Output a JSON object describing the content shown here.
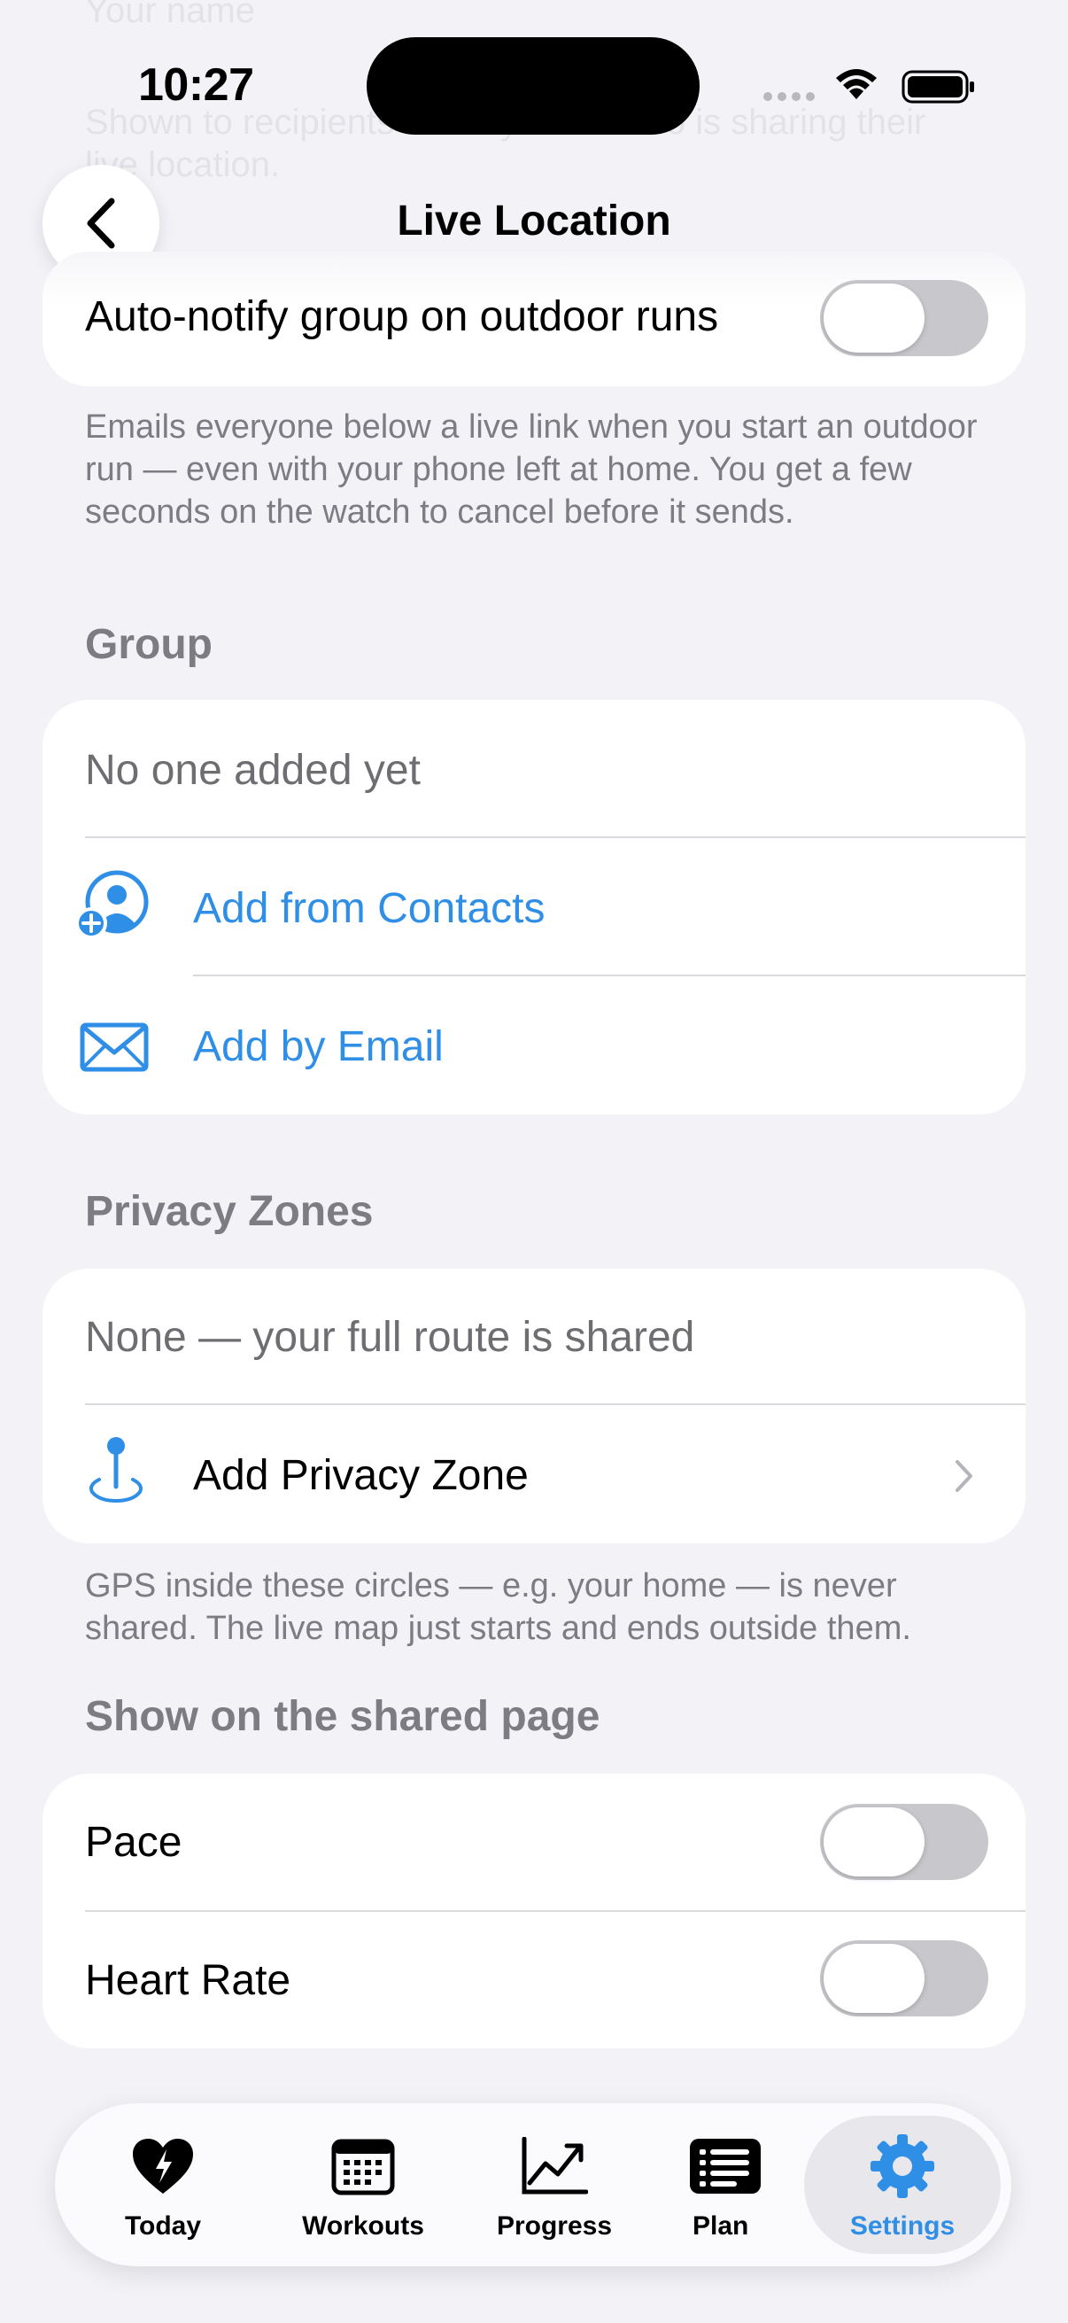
{
  "status_bar": {
    "time": "10:27"
  },
  "background_ghost": {
    "line1": "Your name",
    "line2": "Shown to recipients so they know who is sharing their",
    "line3": "live location."
  },
  "nav": {
    "title": "Live Location",
    "back_icon": "chevron-left-icon"
  },
  "auto_notify": {
    "label": "Auto-notify group on outdoor runs",
    "enabled": false,
    "footer": "Emails everyone below a live link when you start an outdoor run — even with your phone left at home. You get a few seconds on the watch to cancel before it sends."
  },
  "group": {
    "header": "Group",
    "empty_text": "No one added yet",
    "add_contacts_label": "Add from Contacts",
    "add_contacts_icon": "person-add-icon",
    "add_email_label": "Add by Email",
    "add_email_icon": "envelope-icon"
  },
  "privacy_zones": {
    "header": "Privacy Zones",
    "empty_text": "None — your full route is shared",
    "add_label": "Add Privacy Zone",
    "add_icon": "map-pin-icon",
    "footer": "GPS inside these circles — e.g. your home — is never shared. The live map just starts and ends outside them."
  },
  "shared_page": {
    "header": "Show on the shared page",
    "items": [
      {
        "label": "Pace",
        "enabled": false
      },
      {
        "label": "Heart Rate",
        "enabled": false
      }
    ]
  },
  "tabbar": {
    "active": "Settings",
    "tabs": [
      {
        "label": "Today",
        "icon": "heart-bolt-icon"
      },
      {
        "label": "Workouts",
        "icon": "calendar-icon"
      },
      {
        "label": "Progress",
        "icon": "chart-line-icon"
      },
      {
        "label": "Plan",
        "icon": "list-icon"
      },
      {
        "label": "Settings",
        "icon": "gear-icon"
      }
    ]
  },
  "colors": {
    "accent": "#2f8ee6",
    "background": "#f2f2f7",
    "toggle_off": "#c7c7cc"
  }
}
